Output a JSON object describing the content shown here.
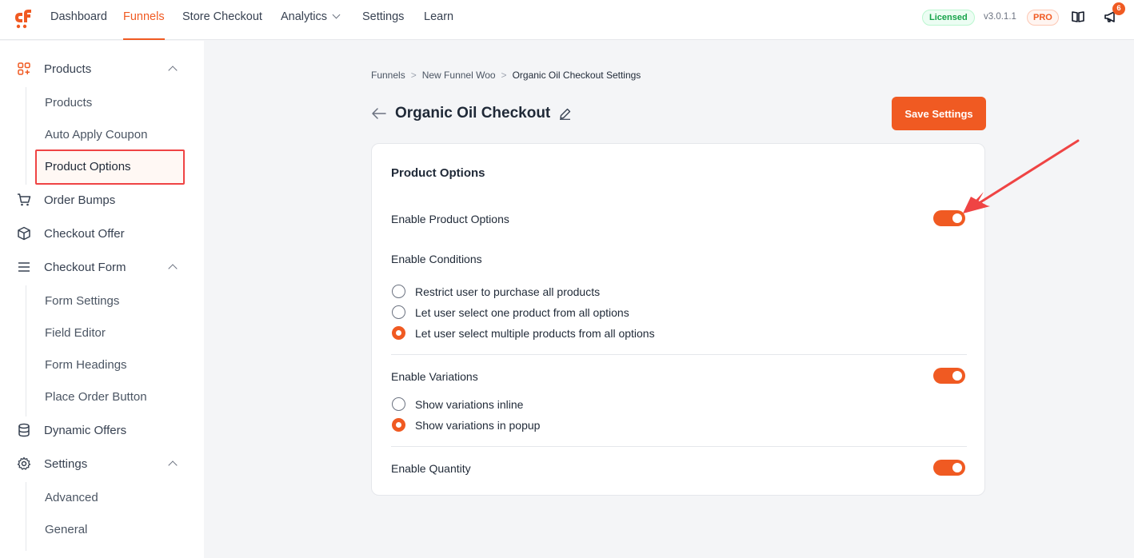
{
  "nav": {
    "items": [
      {
        "label": "Dashboard"
      },
      {
        "label": "Funnels"
      },
      {
        "label": "Store Checkout"
      },
      {
        "label": "Analytics"
      },
      {
        "label": "Settings"
      },
      {
        "label": "Learn"
      }
    ],
    "licensed": "Licensed",
    "version": "v3.0.1.1",
    "pro": "PRO",
    "notifications": "6"
  },
  "sidebar": {
    "products": "Products",
    "products_sub": [
      "Products",
      "Auto Apply Coupon",
      "Product Options"
    ],
    "order_bumps": "Order Bumps",
    "checkout_offer": "Checkout Offer",
    "checkout_form": "Checkout Form",
    "checkout_form_sub": [
      "Form Settings",
      "Field Editor",
      "Form Headings",
      "Place Order Button"
    ],
    "dynamic_offers": "Dynamic Offers",
    "settings": "Settings",
    "settings_sub": [
      "Advanced",
      "General"
    ]
  },
  "breadcrumb": [
    "Funnels",
    "New Funnel Woo",
    "Organic Oil Checkout Settings"
  ],
  "page": {
    "title": "Organic Oil Checkout",
    "save_label": "Save Settings"
  },
  "card": {
    "title": "Product Options",
    "enable_product_options": "Enable Product Options",
    "enable_conditions": "Enable Conditions",
    "conditions": [
      {
        "label": "Restrict user to purchase all products",
        "checked": false
      },
      {
        "label": "Let user select one product from all options",
        "checked": false
      },
      {
        "label": "Let user select multiple products from all options",
        "checked": true
      }
    ],
    "enable_variations": "Enable Variations",
    "variations": [
      {
        "label": "Show variations inline",
        "checked": false
      },
      {
        "label": "Show variations in popup",
        "checked": true
      }
    ],
    "enable_quantity": "Enable Quantity"
  },
  "colors": {
    "accent": "#f05a22",
    "annotation": "#ef4444"
  }
}
